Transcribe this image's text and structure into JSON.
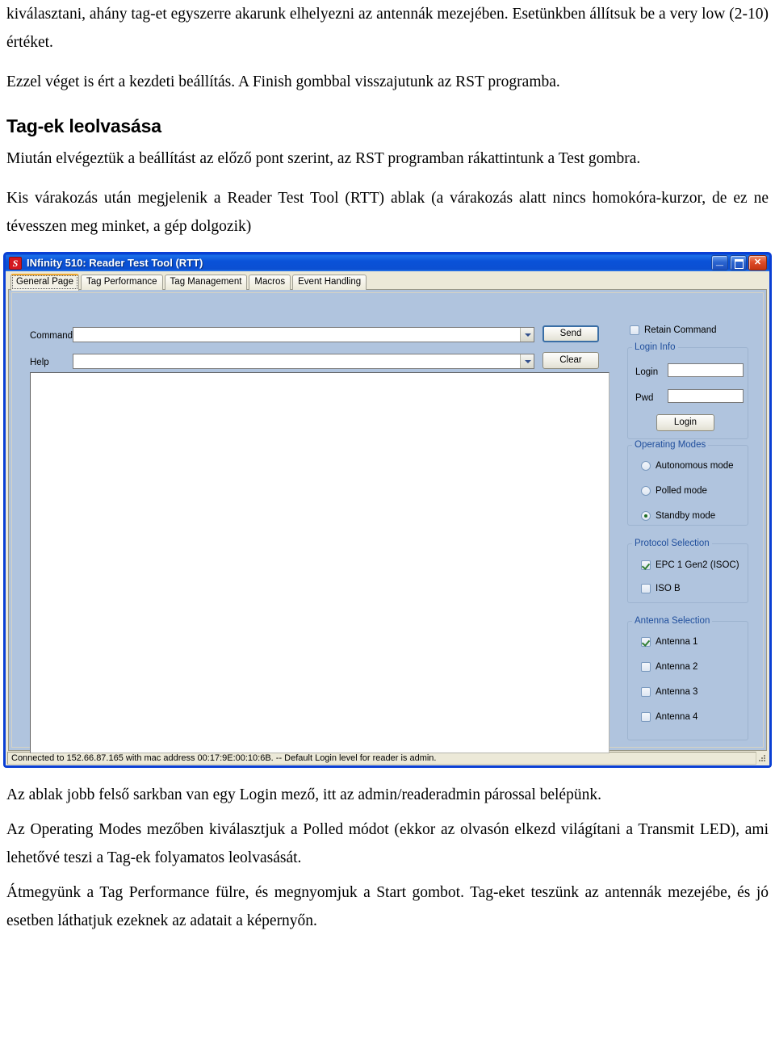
{
  "document": {
    "top_paragraphs": [
      "kiválasztani, ahány tag-et egyszerre akarunk elhelyezni az antennák mezejében. Esetünkben állítsuk be a very low (2-10) értéket.",
      "Ezzel véget is ért a kezdeti beállítás. A Finish gombbal visszajutunk az RST programba."
    ],
    "heading": "Tag-ek leolvasása",
    "mid_paragraphs": [
      "Miután elvégeztük a beállítást az előző pont szerint, az RST programban rákattintunk a Test gombra.",
      "Kis várakozás után megjelenik a Reader Test Tool (RTT) ablak (a várakozás alatt nincs homokóra-kurzor, de ez ne tévesszen meg minket, a gép dolgozik)"
    ],
    "bottom_paragraphs": [
      "Az ablak jobb felső sarkban van egy Login mező, itt az admin/readeradmin párossal belépünk.",
      "Az Operating Modes mezőben kiválasztjuk a Polled módot (ekkor az olvasón elkezd világítani a Transmit LED), ami lehetővé teszi a Tag-ek folyamatos leolvasását.",
      "Átmegyünk a Tag Performance fülre, és megnyomjuk a Start gombot. Tag-eket teszünk az antennák mezejébe, és jó esetben láthatjuk ezeknek az adatait a képernyőn."
    ]
  },
  "window": {
    "title": "INfinity 510: Reader Test Tool (RTT)",
    "app_icon": "s-logo-icon",
    "controls": {
      "minimize": "_",
      "maximize": "□",
      "close": "✕"
    },
    "colors": {
      "titlebar_blue": "#0a52d8",
      "frame_blue": "#0a3fd4",
      "panel_blue": "#b0c4de",
      "chrome_beige": "#ece9d8",
      "group_label_blue": "#1f4e9c",
      "check_green": "#2f7d32",
      "close_red": "#df4c28",
      "tab_selected_accent": "#f0a830"
    },
    "tabs": [
      {
        "label": "General Page",
        "selected": true
      },
      {
        "label": "Tag Performance",
        "selected": false
      },
      {
        "label": "Tag Management",
        "selected": false
      },
      {
        "label": "Macros",
        "selected": false
      },
      {
        "label": "Event Handling",
        "selected": false
      }
    ],
    "general_page": {
      "command": {
        "label": "Command",
        "value": "",
        "placeholder": ""
      },
      "help": {
        "label": "Help",
        "value": "",
        "placeholder": ""
      },
      "send_button": "Send",
      "clear_button": "Clear",
      "output_value": "",
      "retain_command": {
        "label": "Retain Command",
        "checked": false
      },
      "login_info": {
        "title": "Login Info",
        "login": {
          "label": "Login",
          "value": "",
          "placeholder": ""
        },
        "pwd": {
          "label": "Pwd",
          "value": "",
          "placeholder": ""
        },
        "login_button": "Login"
      },
      "operating_modes": {
        "title": "Operating Modes",
        "options": [
          {
            "label": "Autonomous mode",
            "selected": false
          },
          {
            "label": "Polled mode",
            "selected": false
          },
          {
            "label": "Standby mode",
            "selected": true
          }
        ]
      },
      "protocol_selection": {
        "title": "Protocol Selection",
        "options": [
          {
            "label": "EPC 1 Gen2 (ISOC)",
            "checked": true
          },
          {
            "label": "ISO B",
            "checked": false
          }
        ]
      },
      "antenna_selection": {
        "title": "Antenna Selection",
        "options": [
          {
            "label": "Antenna 1",
            "checked": true
          },
          {
            "label": "Antenna 2",
            "checked": false
          },
          {
            "label": "Antenna 3",
            "checked": false
          },
          {
            "label": "Antenna 4",
            "checked": false
          }
        ]
      }
    },
    "status_bar": "Connected to 152.66.87.165 with mac address 00:17:9E:00:10:6B. -- Default Login level for reader is admin."
  }
}
